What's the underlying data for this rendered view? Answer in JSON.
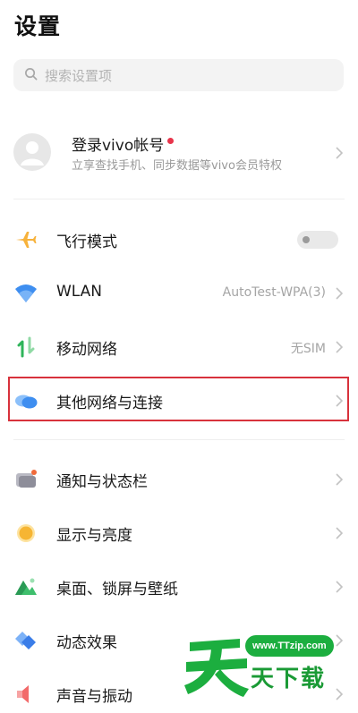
{
  "page": {
    "title": "设置"
  },
  "search": {
    "placeholder": "搜索设置项"
  },
  "account": {
    "name": "登录vivo帐号",
    "subtitle": "立享查找手机、同步数据等vivo会员特权"
  },
  "rows": [
    {
      "id": "airplane",
      "label": "飞行模式",
      "toggle": false,
      "icon": "airplane-icon"
    },
    {
      "id": "wlan",
      "label": "WLAN",
      "value": "AutoTest-WPA(3)",
      "icon": "wifi-icon"
    },
    {
      "id": "mobile",
      "label": "移动网络",
      "value": "无SIM",
      "icon": "mobile-data-icon"
    },
    {
      "id": "other-network",
      "label": "其他网络与连接",
      "icon": "cloud-connection-icon"
    },
    {
      "id": "notifications",
      "label": "通知与状态栏",
      "icon": "notification-icon"
    },
    {
      "id": "display",
      "label": "显示与亮度",
      "icon": "brightness-icon"
    },
    {
      "id": "wallpaper",
      "label": "桌面、锁屏与壁纸",
      "icon": "wallpaper-icon"
    },
    {
      "id": "effects",
      "label": "动态效果",
      "icon": "effects-icon"
    },
    {
      "id": "sound",
      "label": "声音与振动",
      "icon": "sound-icon"
    }
  ],
  "watermark": {
    "url": "www.TTzip.com",
    "text": "天下载"
  },
  "colors": {
    "accent_red": "#d8323c",
    "watermark_green": "#1cae3f"
  }
}
